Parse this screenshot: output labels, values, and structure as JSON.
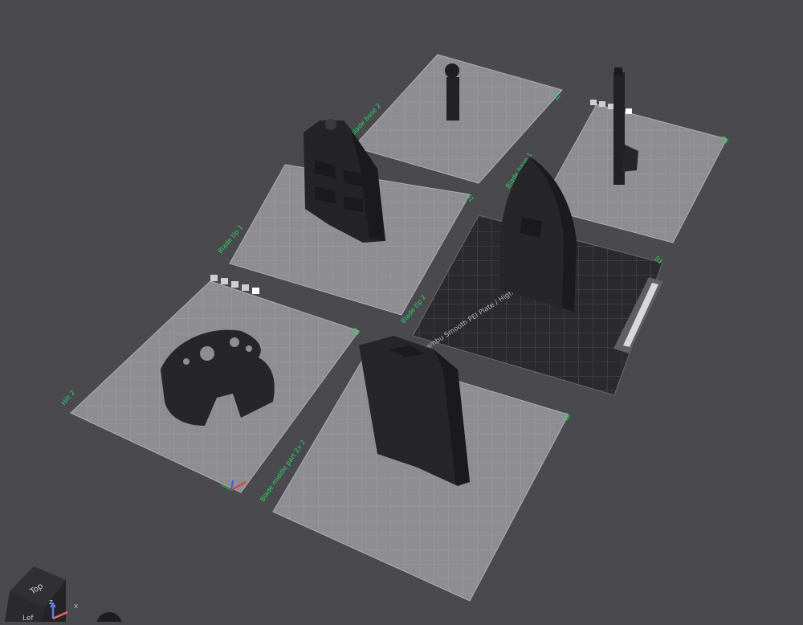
{
  "colors": {
    "background": "#4a494e",
    "plate_fill": "#8d8c91",
    "plate_grid": "#a3a2a7",
    "plate_active_fill": "#2a2a2e",
    "plate_active_grid": "#56565c",
    "label_green": "#2ed36a",
    "model": "#222224"
  },
  "plates": [
    {
      "label": "Blade base 2",
      "number": "01"
    },
    {
      "label": "Blade base 1",
      "number": "03"
    },
    {
      "label": "Blade tip 1",
      "number": "01"
    },
    {
      "label": "Hilt 2",
      "number": "05"
    },
    {
      "label": "Blade middle part 2x 2",
      "number": "06"
    }
  ],
  "active_plate": {
    "label": "Blade tip 2",
    "number": "01",
    "printer_text": "Bambu Smooth PEI Plate / High Temp Plate"
  },
  "toolbar_icons": [
    "arrange-icon",
    "orient-icon",
    "lock-icon",
    "settings-icon",
    "edit-icon"
  ],
  "view_cube": {
    "face_label": "Top",
    "side_label": "Lef"
  },
  "axes": {
    "z": "z",
    "x": "x"
  }
}
